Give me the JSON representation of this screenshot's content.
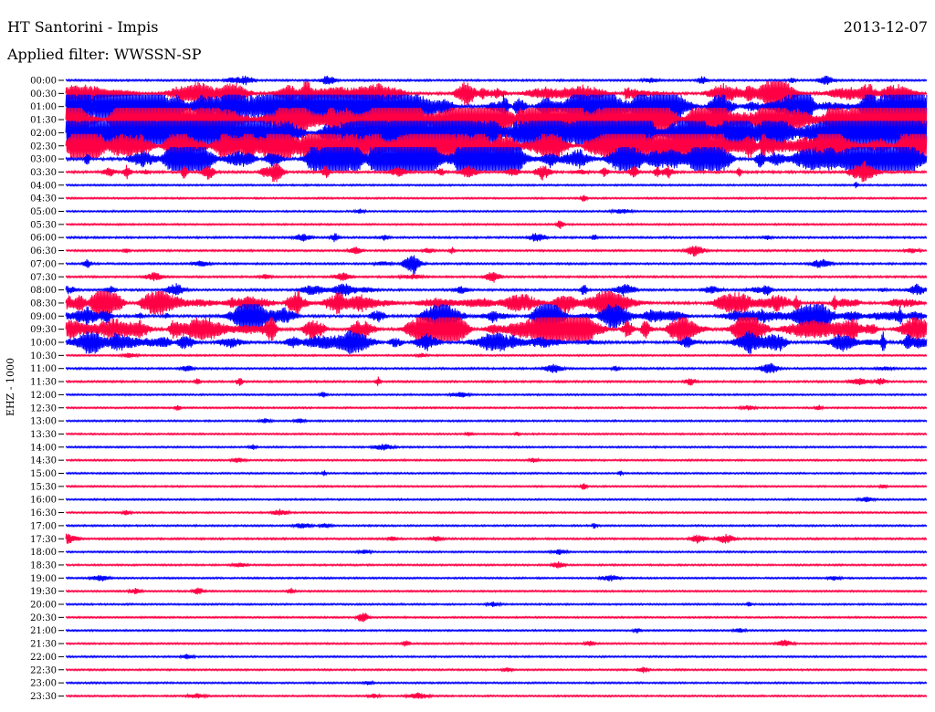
{
  "header": {
    "station": "HT Santorini - Impis",
    "date": "2013-12-07",
    "filter": "Applied filter: WWSSN-SP",
    "channel": "EHZ - 1000"
  },
  "colors": {
    "primary": "#0000ff",
    "secondary": "#ff0044",
    "text": "#000000",
    "background": "#ffffff"
  },
  "chart_data": {
    "type": "line",
    "title": "",
    "xlabel": "",
    "ylabel": "EHZ - 1000",
    "grid": false,
    "legend": "none",
    "row_labels": [
      "00:00",
      "00:30",
      "01:00",
      "01:30",
      "02:00",
      "02:30",
      "03:00",
      "03:30",
      "04:00",
      "04:30",
      "05:00",
      "05:30",
      "06:00",
      "06:30",
      "07:00",
      "07:30",
      "08:00",
      "08:30",
      "09:00",
      "09:30",
      "10:00",
      "10:30",
      "11:00",
      "11:30",
      "12:00",
      "12:30",
      "13:00",
      "13:30",
      "14:00",
      "14:30",
      "15:00",
      "15:30",
      "16:00",
      "16:30",
      "17:00",
      "17:30",
      "18:00",
      "18:30",
      "19:00",
      "19:30",
      "20:00",
      "20:30",
      "21:00",
      "21:30",
      "22:00",
      "22:30",
      "23:00",
      "23:30"
    ],
    "row_activity": [
      2,
      5,
      8,
      9,
      9,
      8,
      7,
      4,
      1,
      1,
      1,
      1,
      2,
      2,
      2,
      2,
      3,
      5,
      5,
      6,
      5,
      1,
      2,
      2,
      1,
      1,
      1,
      1,
      1,
      1,
      1,
      1,
      1,
      1,
      1,
      2,
      1,
      1,
      1,
      1,
      1,
      1,
      1,
      1,
      1,
      1,
      1,
      1
    ]
  }
}
